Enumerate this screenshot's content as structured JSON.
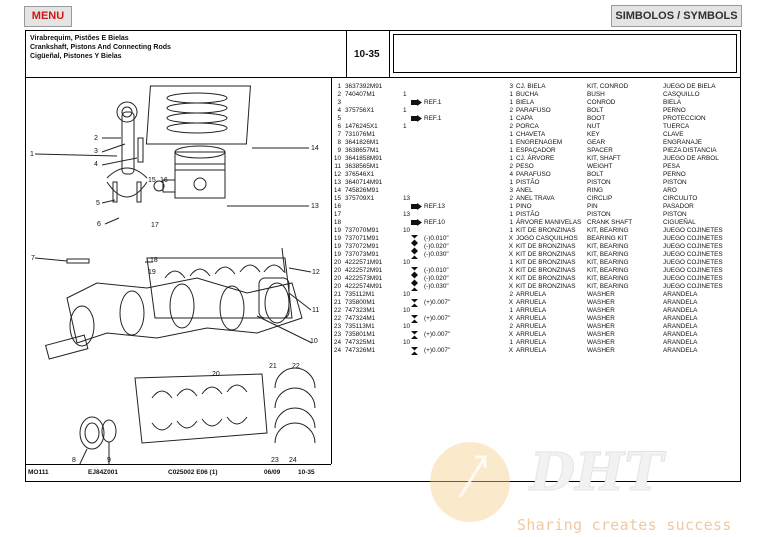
{
  "toolbar": {
    "menu_label": "MENU",
    "symbols_label": "SIMBOLOS / SYMBOLS"
  },
  "header": {
    "title_pt": "Virabrequim, Pistões E Bielas",
    "title_en": "Crankshaft, Pistons And Connecting Rods",
    "title_es": "Cigüeñal, Pistones Y Bielas",
    "page_number": "10-35"
  },
  "footer": {
    "model": "MO111",
    "code": "EJ84Z001",
    "ref": "C025002 E06 (1)",
    "date": "06/09",
    "page": "10-35"
  },
  "callouts": [
    "1",
    "2",
    "3",
    "4",
    "5",
    "6",
    "7",
    "8",
    "9",
    "10",
    "11",
    "12",
    "13",
    "14",
    "15",
    "16",
    "17",
    "18",
    "19",
    "20",
    "21",
    "22",
    "23",
    "24"
  ],
  "parts": [
    {
      "ref": "1",
      "pn": "3637392M91",
      "qty": "",
      "sym": "",
      "note": "",
      "q2": "3",
      "pt": "CJ. BIELA",
      "en": "KIT, CONROD",
      "es": "JUEGO DE BIELA"
    },
    {
      "ref": "2",
      "pn": "740407M1",
      "qty": "1",
      "sym": "",
      "note": "",
      "q2": "1",
      "pt": "BUCHA",
      "en": "BUSH",
      "es": "CASQUILLO"
    },
    {
      "ref": "3",
      "pn": "",
      "qty": "",
      "sym": "arrow",
      "note": "REF.1",
      "q2": "1",
      "pt": "BIELA",
      "en": "CONROD",
      "es": "BIELA"
    },
    {
      "ref": "4",
      "pn": "375756X1",
      "qty": "1",
      "sym": "",
      "note": "",
      "q2": "2",
      "pt": "PARAFUSO",
      "en": "BOLT",
      "es": "PERNO"
    },
    {
      "ref": "5",
      "pn": "",
      "qty": "",
      "sym": "arrow",
      "note": "REF.1",
      "q2": "1",
      "pt": "CAPA",
      "en": "BOOT",
      "es": "PROTECCION"
    },
    {
      "ref": "6",
      "pn": "1476245X1",
      "qty": "1",
      "sym": "",
      "note": "",
      "q2": "2",
      "pt": "PORCA",
      "en": "NUT",
      "es": "TUERCA"
    },
    {
      "ref": "7",
      "pn": "731076M1",
      "qty": "",
      "sym": "",
      "note": "",
      "q2": "1",
      "pt": "CHAVETA",
      "en": "KEY",
      "es": "CLAVE"
    },
    {
      "ref": "8",
      "pn": "3641826M1",
      "qty": "",
      "sym": "",
      "note": "",
      "q2": "1",
      "pt": "ENGRENAGEM",
      "en": "GEAR",
      "es": "ENGRANAJE"
    },
    {
      "ref": "9",
      "pn": "3638657M1",
      "qty": "",
      "sym": "",
      "note": "",
      "q2": "1",
      "pt": "ESPAÇADOR",
      "en": "SPACER",
      "es": "PIEZA DISTANCIA"
    },
    {
      "ref": "10",
      "pn": "3641858M91",
      "qty": "",
      "sym": "",
      "note": "",
      "q2": "1",
      "pt": "CJ. ÁRVORE",
      "en": "KIT, SHAFT",
      "es": "JUEGO DE ARBOL"
    },
    {
      "ref": "11",
      "pn": "3638565M1",
      "qty": "",
      "sym": "",
      "note": "",
      "q2": "2",
      "pt": "PESO",
      "en": "WEIGHT",
      "es": "PESA"
    },
    {
      "ref": "12",
      "pn": "376546X1",
      "qty": "",
      "sym": "",
      "note": "",
      "q2": "4",
      "pt": "PARAFUSO",
      "en": "BOLT",
      "es": "PERNO"
    },
    {
      "ref": "13",
      "pn": "3640714M91",
      "qty": "",
      "sym": "",
      "note": "",
      "q2": "1",
      "pt": "PISTÃO",
      "en": "PISTON",
      "es": "PISTON"
    },
    {
      "ref": "14",
      "pn": "745826M91",
      "qty": "",
      "sym": "",
      "note": "",
      "q2": "3",
      "pt": "ANEL",
      "en": "RING",
      "es": "ARO"
    },
    {
      "ref": "15",
      "pn": "375709X1",
      "qty": "13",
      "sym": "",
      "note": "",
      "q2": "2",
      "pt": "ANEL TRAVA",
      "en": "CIRCLIP",
      "es": "CIRCULITO"
    },
    {
      "ref": "16",
      "pn": "",
      "qty": "",
      "sym": "arrow",
      "note": "REF.13",
      "q2": "1",
      "pt": "PINO",
      "en": "PIN",
      "es": "PASADOR"
    },
    {
      "ref": "17",
      "pn": "",
      "qty": "13",
      "sym": "",
      "note": "",
      "q2": "1",
      "pt": "PISTÃO",
      "en": "PISTON",
      "es": "PISTON"
    },
    {
      "ref": "18",
      "pn": "",
      "qty": "",
      "sym": "arrow",
      "note": "REF.10",
      "q2": "1",
      "pt": "ÁRVORE MANIVELAS",
      "en": "CRANK SHAFT",
      "es": "CIGUEÑAL"
    },
    {
      "ref": "19",
      "pn": "737070M91",
      "qty": "10",
      "sym": "",
      "note": "",
      "q2": "1",
      "pt": "KIT DE BRONZINAS",
      "en": "KIT, BEARING",
      "es": "JUEGO COJINETES"
    },
    {
      "ref": "19",
      "pn": "737071M91",
      "qty": "",
      "sym": "updown",
      "note": "(-)0.010\"",
      "q2": "X",
      "pt": "JOGO CASQUILHOS",
      "en": "BEARING KIT",
      "es": "JUEGO COJINETES"
    },
    {
      "ref": "19",
      "pn": "737072M91",
      "qty": "",
      "sym": "updown",
      "note": "(-)0.020\"",
      "q2": "X",
      "pt": "KIT DE BRONZINAS",
      "en": "KIT, BEARING",
      "es": "JUEGO COJINETES"
    },
    {
      "ref": "19",
      "pn": "737073M91",
      "qty": "",
      "sym": "updown",
      "note": "(-)0.030\"",
      "q2": "X",
      "pt": "KIT DE BRONZINAS",
      "en": "KIT, BEARING",
      "es": "JUEGO COJINETES"
    },
    {
      "ref": "20",
      "pn": "4222571M91",
      "qty": "10",
      "sym": "",
      "note": "",
      "q2": "1",
      "pt": "KIT DE BRONZINAS",
      "en": "KIT, BEARING",
      "es": "JUEGO COJINETES"
    },
    {
      "ref": "20",
      "pn": "4222572M91",
      "qty": "",
      "sym": "updown",
      "note": "(-)0.010\"",
      "q2": "X",
      "pt": "KIT DE BRONZINAS",
      "en": "KIT, BEARING",
      "es": "JUEGO COJINETES"
    },
    {
      "ref": "20",
      "pn": "4222573M91",
      "qty": "",
      "sym": "updown",
      "note": "(-)0.020\"",
      "q2": "X",
      "pt": "KIT DE BRONZINAS",
      "en": "KIT, BEARING",
      "es": "JUEGO COJINETES"
    },
    {
      "ref": "20",
      "pn": "4222574M91",
      "qty": "",
      "sym": "updown",
      "note": "(-)0.030\"",
      "q2": "X",
      "pt": "KIT DE BRONZINAS",
      "en": "KIT, BEARING",
      "es": "JUEGO COJINETES"
    },
    {
      "ref": "21",
      "pn": "735112M1",
      "qty": "10",
      "sym": "",
      "note": "",
      "q2": "2",
      "pt": "ARRUELA",
      "en": "WASHER",
      "es": "ARANDELA"
    },
    {
      "ref": "21",
      "pn": "735800M1",
      "qty": "",
      "sym": "updown",
      "note": "(+)0.007\"",
      "q2": "X",
      "pt": "ARRUELA",
      "en": "WASHER",
      "es": "ARANDELA"
    },
    {
      "ref": "22",
      "pn": "747323M1",
      "qty": "10",
      "sym": "",
      "note": "",
      "q2": "1",
      "pt": "ARRUELA",
      "en": "WASHER",
      "es": "ARANDELA"
    },
    {
      "ref": "22",
      "pn": "747324M1",
      "qty": "",
      "sym": "updown",
      "note": "(+)0.007\"",
      "q2": "X",
      "pt": "ARRUELA",
      "en": "WASHER",
      "es": "ARANDELA"
    },
    {
      "ref": "23",
      "pn": "735113M1",
      "qty": "10",
      "sym": "",
      "note": "",
      "q2": "2",
      "pt": "ARRUELA",
      "en": "WASHER",
      "es": "ARANDELA"
    },
    {
      "ref": "23",
      "pn": "735801M1",
      "qty": "",
      "sym": "updown",
      "note": "(+)0.007\"",
      "q2": "X",
      "pt": "ARRUELA",
      "en": "WASHER",
      "es": "ARANDELA"
    },
    {
      "ref": "24",
      "pn": "747325M1",
      "qty": "10",
      "sym": "",
      "note": "",
      "q2": "1",
      "pt": "ARRUELA",
      "en": "WASHER",
      "es": "ARANDELA"
    },
    {
      "ref": "24",
      "pn": "747326M1",
      "qty": "",
      "sym": "updown",
      "note": "(+)0.007\"",
      "q2": "X",
      "pt": "ARRUELA",
      "en": "WASHER",
      "es": "ARANDELA"
    }
  ],
  "watermark": {
    "logo": "DHT",
    "tagline": "Sharing creates success"
  }
}
